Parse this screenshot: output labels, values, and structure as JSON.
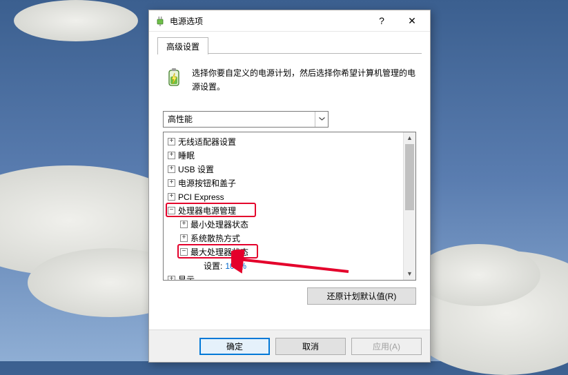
{
  "window": {
    "title": "电源选项",
    "help_symbol": "?",
    "close_symbol": "✕"
  },
  "tabs": {
    "advanced": "高级设置"
  },
  "description": "选择你要自定义的电源计划，然后选择你希望计算机管理的电源设置。",
  "plan_selected": "高性能",
  "tree": {
    "wireless": "无线适配器设置",
    "sleep": "睡眠",
    "usb": "USB 设置",
    "powerbtn": "电源按钮和盖子",
    "pci": "PCI Express",
    "cpu": "处理器电源管理",
    "cpu_min": "最小处理器状态",
    "cooling": "系统散热方式",
    "cpu_max": "最大处理器状态",
    "setting_label": "设置:",
    "setting_value": "100%",
    "display": "显示"
  },
  "buttons": {
    "restore": "还原计划默认值(R)",
    "ok": "确定",
    "cancel": "取消",
    "apply": "应用(A)"
  }
}
